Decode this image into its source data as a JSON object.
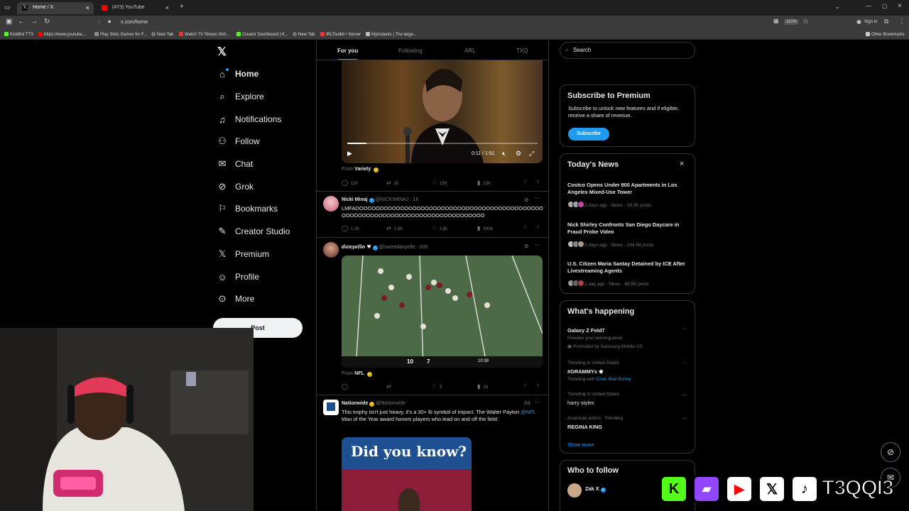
{
  "browser": {
    "tabs": [
      {
        "label": "Home / X",
        "active": true
      },
      {
        "label": "(473) YouTube",
        "active": false
      }
    ],
    "new_tab": "+",
    "url": "x.com/home",
    "zoom": "110%",
    "signin": "Sign in",
    "bookmarks": [
      "KickBot TTS",
      "https://www.youtube....",
      "Play Slots Games for F...",
      "New Tab",
      "Watch TV Shows Onli...",
      "Creator Dashboard | K...",
      "New Tab",
      "IRLToolkit • Server",
      "Myinstants | The large..."
    ],
    "other_bookmarks": "Other Bookmarks"
  },
  "nav": {
    "items": [
      {
        "label": "Home",
        "icon": "home-icon"
      },
      {
        "label": "Explore",
        "icon": "search-icon"
      },
      {
        "label": "Notifications",
        "icon": "bell-icon"
      },
      {
        "label": "Follow",
        "icon": "person-add-icon"
      },
      {
        "label": "Chat",
        "icon": "mail-icon"
      },
      {
        "label": "Grok",
        "icon": "grok-icon"
      },
      {
        "label": "Bookmarks",
        "icon": "bookmark-icon"
      },
      {
        "label": "Creator Studio",
        "icon": "creator-icon"
      },
      {
        "label": "Premium",
        "icon": "x-icon"
      },
      {
        "label": "Profile",
        "icon": "person-icon"
      },
      {
        "label": "More",
        "icon": "more-icon"
      }
    ],
    "post_label": "Post"
  },
  "feed": {
    "tabs": [
      "For you",
      "Following",
      "ARL",
      "TXQ"
    ],
    "tweet1": {
      "video_time": "0:11 / 1:51",
      "from_label": "From",
      "from_name": "Variety",
      "replies": "130",
      "reposts": "20",
      "likes": "159",
      "views": "23K"
    },
    "tweet2": {
      "name": "Nicki Minaj",
      "handle": "@NICKIMINAJ",
      "time": "· 1h",
      "text": "LMFAOOOOOOOOOOOOOOOOOOOOOOOOOOOOOOOOOOOOOOOOOOOOOOOOOOOOOOOOOOOOOOOOOOOOOOOOOOOOOOOOO",
      "replies": "1.3K",
      "reposts": "1.8K",
      "likes": "13K",
      "views": "590K"
    },
    "tweet3": {
      "name": "danyello ♥",
      "handle": "@sareedanyelle",
      "time": "· 20h",
      "from_label": "From",
      "from_name": "NFL",
      "likes": "9",
      "views": "1K",
      "score_left": "10",
      "score_right": "7",
      "clock": "10:39"
    },
    "tweet4": {
      "name": "Nationwide",
      "handle": "@Nationwide",
      "ad": "Ad",
      "text_pre": "This trophy isn't just heavy, it's a 30+ lb symbol of impact. The Walter Payton ",
      "text_link": "@NFL",
      "text_post": " Man of the Year award honors players who lead on and off the field.",
      "banner": "Did you know?"
    }
  },
  "rail": {
    "search_placeholder": "Search",
    "premium": {
      "title": "Subscribe to Premium",
      "body": "Subscribe to unlock new features and if eligible, receive a share of revenue.",
      "button": "Subscribe"
    },
    "news": {
      "title": "Today's News",
      "items": [
        {
          "headline": "Costco Opens Under 800 Apartments in Los Angeles Mixed-Use Tower",
          "meta": "2 days ago · News · 19.3K posts"
        },
        {
          "headline": "Nick Shirley Confronts San Diego Daycare in Fraud Probe Video",
          "meta": "2 days ago · News · 144.5K posts"
        },
        {
          "headline": "U.S. Citizen Maria Santay Detained by ICE After Livestreaming Agents",
          "meta": "1 day ago · News · 68.5K posts"
        }
      ]
    },
    "happening": {
      "title": "What's happening",
      "items": [
        {
          "name": "Galaxy Z Fold7",
          "sub": "Preview your winning pose",
          "promo": "Promoted by Samsung Mobile US"
        },
        {
          "context": "Trending in United States",
          "name": "#GRAMMYs",
          "with_label": "Trending with",
          "with": "Cher, Bad Bunny"
        },
        {
          "context": "Trending in United States",
          "name": "harry styles"
        },
        {
          "context": "American actors · Trending",
          "name": "REGINA KING"
        }
      ],
      "show_more": "Show more"
    },
    "follow": {
      "title": "Who to follow",
      "name": "Zak X"
    }
  },
  "overlay": {
    "brand": "T3QQI3",
    "kick": "K"
  },
  "colors": {
    "accent": "#1d9bf0",
    "background": "#000000",
    "border": "#2f3336"
  }
}
